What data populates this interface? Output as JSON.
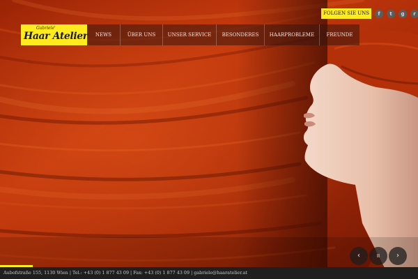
{
  "logo": {
    "subtitle": "Gabriele'",
    "name": "Haar Atelier"
  },
  "social": {
    "follow_label": "FOLGEN SIE UNS",
    "icons": [
      {
        "name": "facebook-icon",
        "glyph": "f"
      },
      {
        "name": "twitter-icon",
        "glyph": "t"
      },
      {
        "name": "google-plus-icon",
        "glyph": "g"
      },
      {
        "name": "rss-icon",
        "glyph": "r"
      }
    ]
  },
  "nav": {
    "items": [
      "NEWS",
      "ÜBER UNS",
      "UNSER SERVICE",
      "BESONDERES",
      "HAARPROBLEME",
      "FREUNDE"
    ]
  },
  "slider": {
    "prev_icon": "‹",
    "pause_icon": "II",
    "next_icon": "›"
  },
  "footer": {
    "text": "Aubofstraße 155, 1130 Wien | Tel.: +43 (0) 1 877 43 09 | Fax: +43 (0) 1 877 43 09 | gabriele@haaratelier.at"
  },
  "colors": {
    "accent_yellow": "#ffeb1f",
    "hair_red": "#b8300a",
    "footer_bg": "#1f1f1f"
  }
}
